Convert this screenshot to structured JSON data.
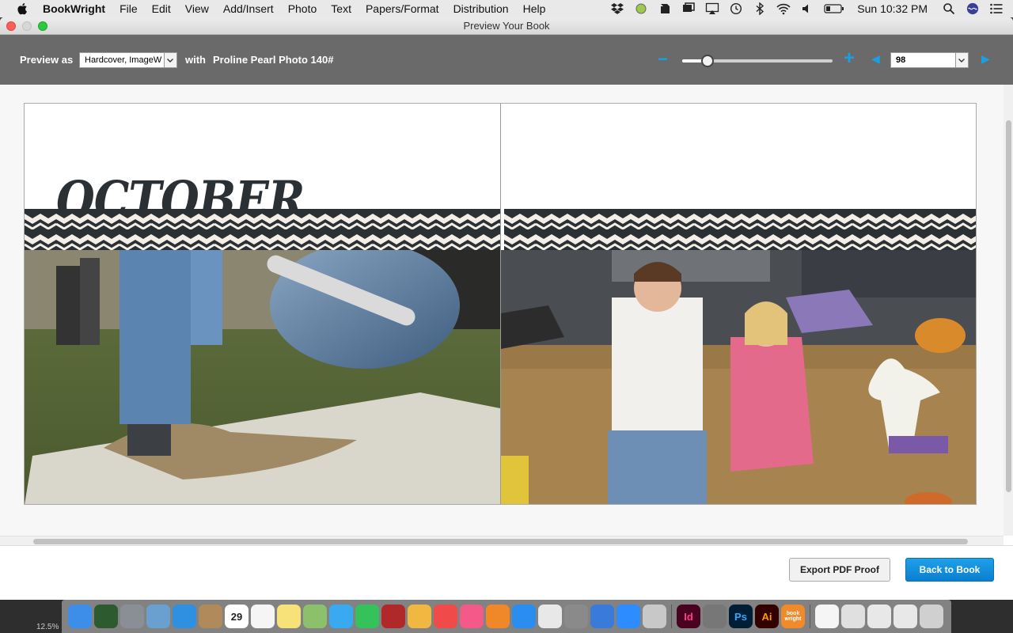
{
  "menubar": {
    "app_name": "BookWright",
    "items": [
      "File",
      "Edit",
      "View",
      "Add/Insert",
      "Photo",
      "Text",
      "Papers/Format",
      "Distribution",
      "Help"
    ],
    "clock": "Sun 10:32 PM",
    "tray_icons": [
      "dropbox-icon",
      "status-dot-icon",
      "evernote-icon",
      "screens-icon",
      "airplay-icon",
      "time-machine-icon",
      "bluetooth-icon",
      "wifi-icon",
      "volume-icon",
      "battery-icon",
      "spotlight-icon",
      "siri-icon",
      "notification-center-icon"
    ]
  },
  "window": {
    "title": "Preview Your Book"
  },
  "toolbar": {
    "preview_as_label": "Preview as",
    "cover_select_value": "Hardcover, ImageW",
    "with_label": "with",
    "paper_name": "Proline Pearl Photo 140#",
    "zoom_level_fraction": 0.17,
    "page_number": "98"
  },
  "spread": {
    "left_page_title": "OCTOBER",
    "left_photo": "boy-stepping-off-slide-photo",
    "right_photo": "two-kids-on-hay-bales-photo",
    "band_color": "#2b3034",
    "band_light": "#f3efe7"
  },
  "footer": {
    "export_label": "Export PDF Proof",
    "back_label": "Back to Book"
  },
  "dock": {
    "zoom_label": "12.5%",
    "apps": [
      {
        "name": "finder",
        "color": "#3d8ee8"
      },
      {
        "name": "mission-control",
        "color": "#2d5a2e"
      },
      {
        "name": "launchpad",
        "color": "#8a8f96"
      },
      {
        "name": "preview",
        "color": "#6aa0d0"
      },
      {
        "name": "safari",
        "color": "#2f8fe0"
      },
      {
        "name": "contacts",
        "color": "#b08a5a"
      },
      {
        "name": "calendar",
        "color": "#ffffff"
      },
      {
        "name": "reminders",
        "color": "#f5f5f5"
      },
      {
        "name": "notes",
        "color": "#f7e27a"
      },
      {
        "name": "maps",
        "color": "#8cc06a"
      },
      {
        "name": "messages",
        "color": "#3aaaf0"
      },
      {
        "name": "facetime",
        "color": "#35c25a"
      },
      {
        "name": "photo-booth",
        "color": "#b0282a"
      },
      {
        "name": "photos",
        "color": "#f0b840"
      },
      {
        "name": "news",
        "color": "#f04a4a"
      },
      {
        "name": "music",
        "color": "#f35a8a"
      },
      {
        "name": "books",
        "color": "#f0882a"
      },
      {
        "name": "app-store",
        "color": "#2a8ef0"
      },
      {
        "name": "textedit",
        "color": "#e8e8e8"
      },
      {
        "name": "system-preferences",
        "color": "#8a8a8a"
      },
      {
        "name": "keynote",
        "color": "#3a7ad8"
      },
      {
        "name": "zoom",
        "color": "#2d8cff"
      },
      {
        "name": "disk-utility",
        "color": "#c8c8c8"
      },
      {
        "name": "indesign",
        "color": "#49021f"
      },
      {
        "name": "keychain",
        "color": "#777777"
      },
      {
        "name": "photoshop",
        "color": "#001e36"
      },
      {
        "name": "illustrator",
        "color": "#330000"
      },
      {
        "name": "bookwright",
        "color": "#f08a2a"
      },
      {
        "name": "document",
        "color": "#f5f5f5"
      },
      {
        "name": "downloads-stack-1",
        "color": "#e0e0e0"
      },
      {
        "name": "downloads-stack-2",
        "color": "#e8e8e8"
      },
      {
        "name": "downloads-stack-3",
        "color": "#e8e8e8"
      },
      {
        "name": "trash",
        "color": "#d0d0d0"
      }
    ],
    "labels": {
      "indesign": "Id",
      "photoshop": "Ps",
      "illustrator": "Ai",
      "calendar": "29",
      "bookwright": "book wright"
    }
  }
}
